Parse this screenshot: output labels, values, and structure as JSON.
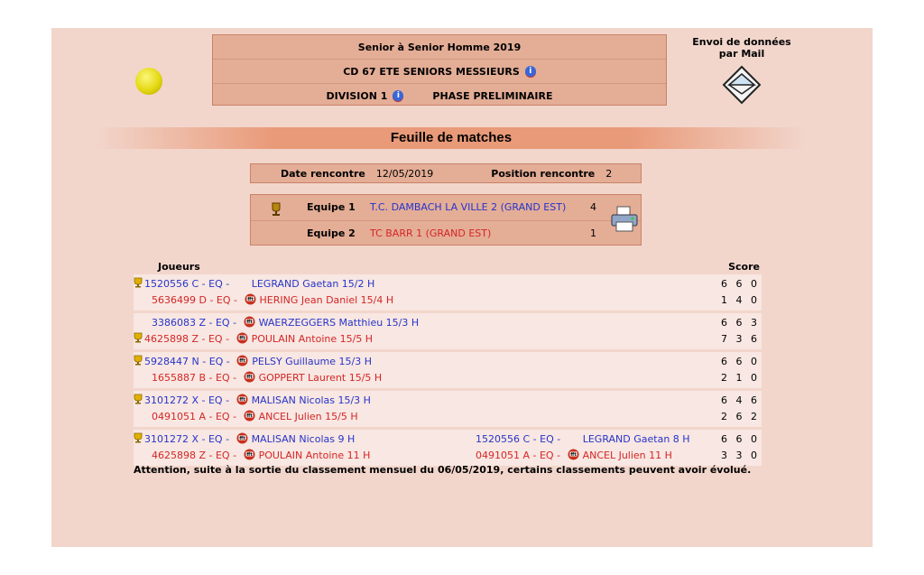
{
  "header": {
    "line1": "Senior à Senior Homme 2019",
    "line2": "CD 67 ETE SENIORS MESSIEURS",
    "division": "DIVISION 1",
    "phase": "PHASE PRELIMINAIRE"
  },
  "mail": {
    "title_line1": "Envoi de données",
    "title_line2": "par Mail"
  },
  "section_title": "Feuille de matches",
  "meeting": {
    "date_label": "Date rencontre",
    "date_value": "12/05/2019",
    "position_label": "Position rencontre",
    "position_value": "2"
  },
  "teams": [
    {
      "label": "Equipe 1",
      "name": "T.C. DAMBACH LA VILLE 2 (GRAND EST)",
      "score": "4"
    },
    {
      "label": "Equipe 2",
      "name": "TC BARR 1 (GRAND EST)",
      "score": "1"
    }
  ],
  "table": {
    "col_players": "Joueurs",
    "col_score": "Score",
    "matches": [
      {
        "p1": {
          "lic": "1520556 C - ",
          "eq": "EQ - ",
          "name": "LEGRAND  Gaetan  15/2 H",
          "winner": true,
          "ff": false
        },
        "p2": {
          "lic": "5636499 D - ",
          "eq": "EQ - ",
          "name": "HERING  Jean Daniel 15/4 H",
          "winner": false,
          "ff": true
        },
        "s1": "6 6 0",
        "s2": "1 4 0"
      },
      {
        "p1": {
          "lic": "3386083 Z - ",
          "eq": "EQ - ",
          "name": "WAERZEGGERS  Matthieu  15/3 H",
          "winner": false,
          "ff": true
        },
        "p2": {
          "lic": "4625898 Z - ",
          "eq": "EQ - ",
          "name": "POULAIN  Antoine 15/5 H",
          "winner": true,
          "ff": true
        },
        "s1": "6 6 3",
        "s2": "7 3 6"
      },
      {
        "p1": {
          "lic": "5928447 N - ",
          "eq": "EQ - ",
          "name": "PELSY  Guillaume  15/3 H",
          "winner": true,
          "ff": true
        },
        "p2": {
          "lic": "1655887 B - ",
          "eq": "EQ - ",
          "name": "GOPPERT  Laurent 15/5 H",
          "winner": false,
          "ff": true
        },
        "s1": "6 6 0",
        "s2": "2 1 0"
      },
      {
        "p1": {
          "lic": "3101272 X - ",
          "eq": "EQ - ",
          "name": "MALISAN  Nicolas  15/3 H",
          "winner": true,
          "ff": true
        },
        "p2": {
          "lic": "0491051 A - ",
          "eq": "EQ - ",
          "name": "ANCEL  Julien 15/5 H",
          "winner": false,
          "ff": true
        },
        "s1": "6 4 6",
        "s2": "2 6 2"
      }
    ],
    "double": {
      "p1": {
        "lic": "3101272 X - ",
        "eq": "EQ - ",
        "name": "MALISAN  Nicolas  9 H"
      },
      "p2": {
        "lic": "4625898 Z - ",
        "eq": "EQ - ",
        "name": "POULAIN  Antoine 11 H"
      },
      "p3": {
        "lic": "1520556 C - ",
        "eq": "EQ - ",
        "name": "LEGRAND  Gaetan  8 H"
      },
      "p4": {
        "lic": "0491051 A - ",
        "eq": "EQ - ",
        "name": "ANCEL  Julien 11 H"
      },
      "s1": "6 6 0",
      "s2": "3 3 0"
    }
  },
  "note": "Attention, suite à la sortie du classement mensuel du 06/05/2019, certains classements peuvent avoir évolué.",
  "colors": {
    "panel": "#f2d6cc",
    "box": "#e4ad96",
    "blue_team": "#2734c9",
    "red_team": "#d42626"
  },
  "icons": {
    "ball": "tennis-ball-icon",
    "mail": "envelope-icon",
    "trophy": "trophy-icon",
    "print": "printer-icon",
    "ff": "federation-logo-icon"
  }
}
